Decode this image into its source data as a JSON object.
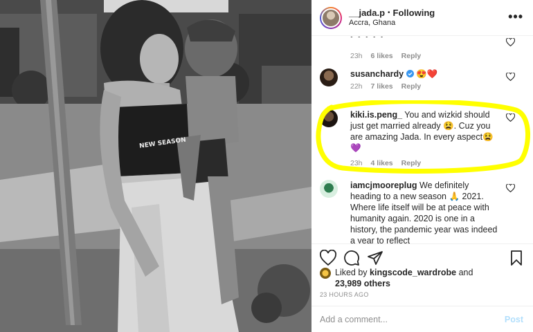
{
  "photo": {
    "shirt_text": "NEW SEASON"
  },
  "header": {
    "username": "__jada.p",
    "separator": "•",
    "follow_state": "Following",
    "location": "Accra, Ghana",
    "more": "•••"
  },
  "comments": [
    {
      "username": "",
      "text": "",
      "emojis": "• • • • •",
      "time": "23h",
      "likes": "6 likes",
      "reply": "Reply"
    },
    {
      "username": "susanchardy",
      "text": "",
      "emojis": "😍❤️",
      "time": "22h",
      "likes": "7 likes",
      "reply": "Reply"
    },
    {
      "username": "kiki.is.peng_",
      "text": "You and wizkid should just get married already 😫. Cuz you are amazing Jada. In every aspect😫💜",
      "time": "23h",
      "likes": "4 likes",
      "reply": "Reply"
    },
    {
      "username": "iamcjmooreplug",
      "text": "We definitely heading to a new season 🙏 2021. Where life itself will be at peace with humanity again. 2020 is one in a history, the pandemic year was indeed a year to reflect"
    }
  ],
  "likes": {
    "prefix": "Liked by",
    "user": "kingscode_wardrobe",
    "middle": "and",
    "count": "23,989 others"
  },
  "time_ago": "23 HOURS AGO",
  "add_comment": {
    "placeholder": "Add a comment...",
    "post": "Post"
  },
  "colors": {
    "highlight": "#ffff00",
    "verified": "#3897f0",
    "muted": "#8e8e8e",
    "post_disabled": "#b2dffc"
  }
}
